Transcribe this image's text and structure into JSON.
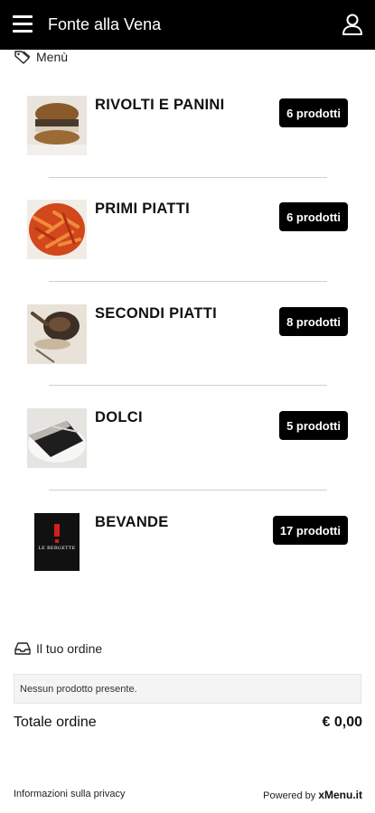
{
  "header": {
    "title": "Fonte alla Vena",
    "menu_icon": "hamburger-icon",
    "user_icon": "user-icon"
  },
  "menu_section": {
    "label": "Menù",
    "icon": "tag-icon"
  },
  "categories": [
    {
      "name": "RIVOLTI E PANINI",
      "count_label": "6 prodotti",
      "thumb": "burger-photo"
    },
    {
      "name": "PRIMI PIATTI",
      "count_label": "6 prodotti",
      "thumb": "pasta-photo"
    },
    {
      "name": "SECONDI PIATTI",
      "count_label": "8 prodotti",
      "thumb": "roast-meat-photo"
    },
    {
      "name": "DOLCI",
      "count_label": "5 prodotti",
      "thumb": "cake-photo"
    },
    {
      "name": "BEVANDE",
      "count_label": "17 prodotti",
      "thumb": "wine-label-photo",
      "thumb_text": "LE BERGETTE"
    }
  ],
  "order": {
    "label": "Il tuo ordine",
    "icon": "inbox-icon",
    "empty_text": "Nessun prodotto presente.",
    "total_label": "Totale ordine",
    "total_value": "€ 0,00"
  },
  "footer": {
    "privacy_link": "Informazioni sulla privacy",
    "powered_by": "Powered by",
    "brand": "xMenu.it"
  },
  "colors": {
    "topbar": "#000000",
    "badge": "#000000",
    "divider": "#cfcfcf"
  }
}
